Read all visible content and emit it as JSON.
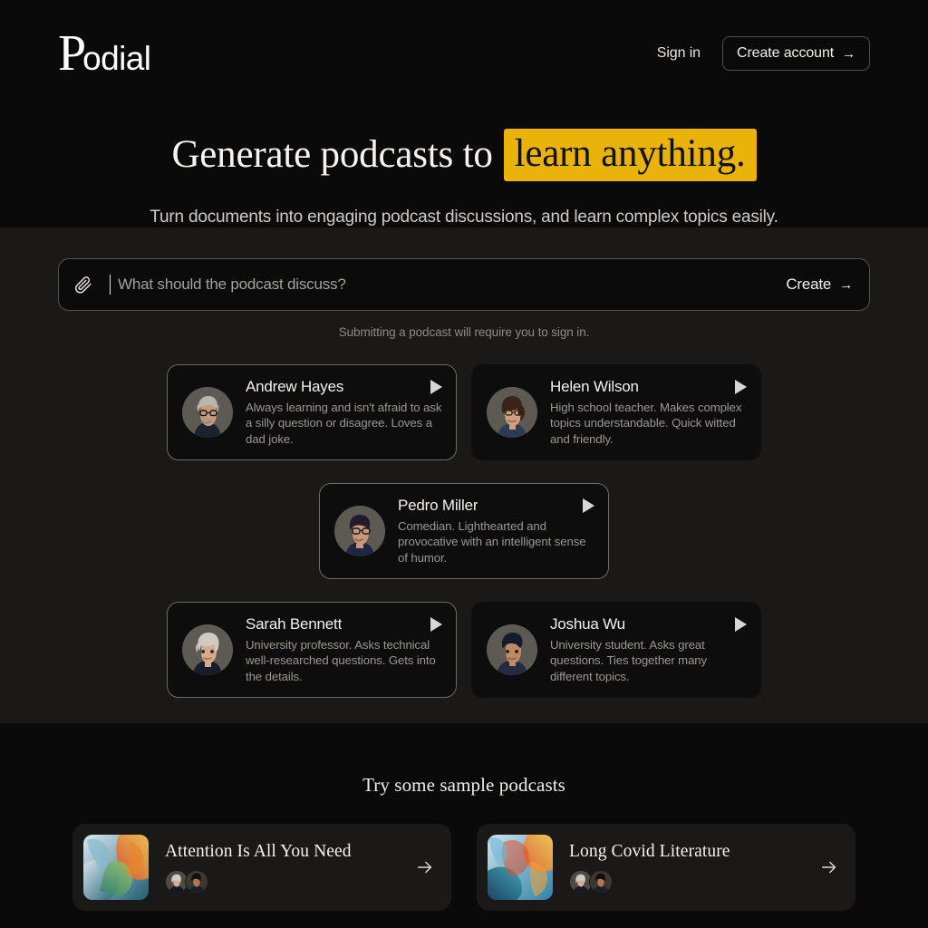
{
  "brand": {
    "logo_serif": "P",
    "logo_rest": "odial"
  },
  "header": {
    "signin_label": "Sign in",
    "create_account_label": "Create account",
    "create_account_arrow": "→"
  },
  "hero": {
    "headline_plain": "Generate podcasts to",
    "headline_highlight": "learn anything.",
    "highlight_color": "#e9b30c",
    "subtitle": "Turn documents into engaging podcast discussions, and learn complex topics easily."
  },
  "prompt": {
    "attach_icon": "paperclip-icon",
    "value": "",
    "placeholder": "What should the podcast discuss?",
    "create_label": "Create",
    "create_arrow": "→",
    "note": "Submitting a podcast will require you to sign in."
  },
  "personas": {
    "rows": [
      [
        {
          "name": "Andrew Hayes",
          "description": "Always learning and isn't afraid to ask a silly question or disagree. Loves a dad joke.",
          "selected": true,
          "play_icon": "play-icon"
        },
        {
          "name": "Helen Wilson",
          "description": "High school teacher. Makes complex topics understandable. Quick witted and friendly.",
          "selected": false,
          "play_icon": "play-icon"
        }
      ],
      [
        {
          "name": "Pedro Miller",
          "description": "Comedian. Lighthearted and provocative with an intelligent sense of humor.",
          "selected": true,
          "play_icon": "play-icon"
        }
      ],
      [
        {
          "name": "Sarah Bennett",
          "description": "University professor. Asks technical well-researched questions. Gets into the details.",
          "selected": true,
          "play_icon": "play-icon"
        },
        {
          "name": "Joshua Wu",
          "description": "University student. Asks great questions. Ties together many different topics.",
          "selected": false,
          "play_icon": "play-icon"
        }
      ]
    ]
  },
  "samples": {
    "title": "Try some sample podcasts",
    "items": [
      {
        "title": "Attention Is All You Need",
        "arrow": "→"
      },
      {
        "title": "Long Covid Literature",
        "arrow": "→"
      }
    ]
  }
}
